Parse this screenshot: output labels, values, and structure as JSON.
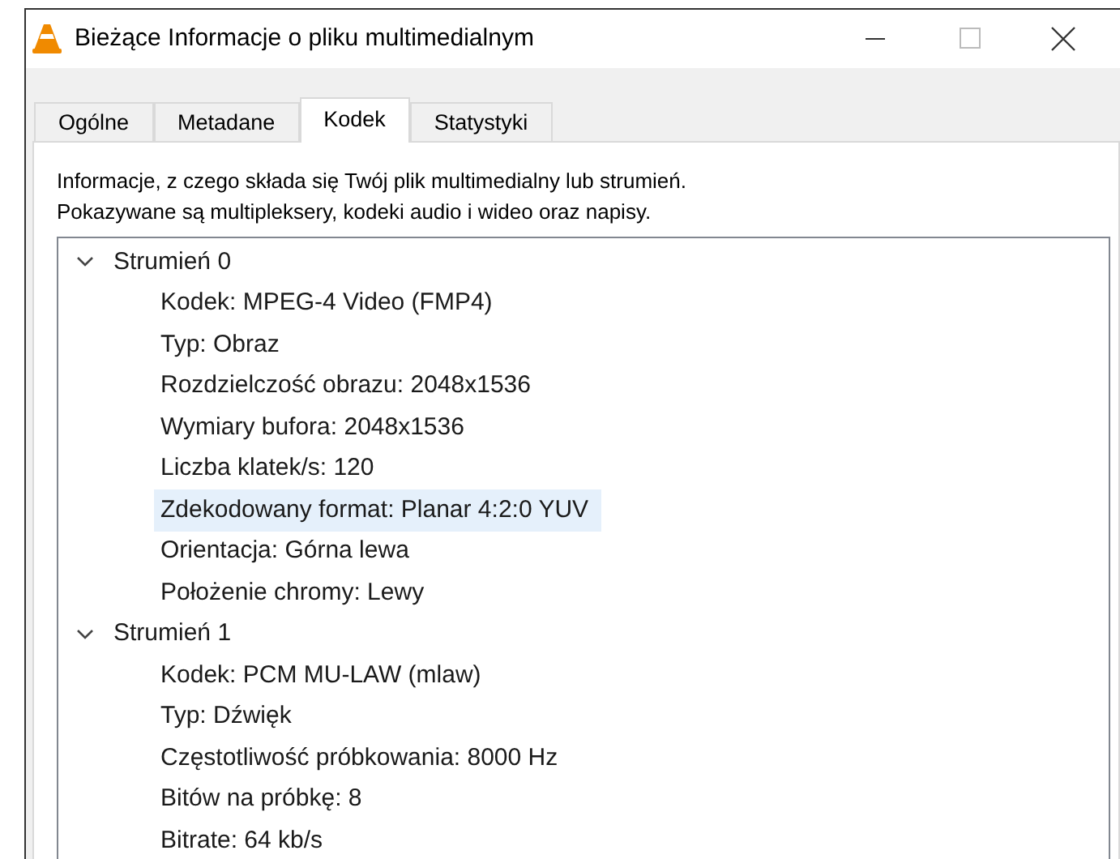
{
  "window": {
    "title": "Bieżące Informacje o pliku multimedialnym"
  },
  "tabs": [
    {
      "label": "Ogólne",
      "selected": false
    },
    {
      "label": "Metadane",
      "selected": false
    },
    {
      "label": "Kodek",
      "selected": true
    },
    {
      "label": "Statystyki",
      "selected": false
    }
  ],
  "description": [
    "Informacje, z czego składa się Twój plik multimedialny lub strumień.",
    "Pokazywane są multipleksery, kodeki audio i wideo oraz napisy."
  ],
  "tree": [
    {
      "label": "Strumień 0",
      "expanded": true,
      "children": [
        {
          "label": "Kodek: MPEG-4 Video (FMP4)",
          "selected": false
        },
        {
          "label": "Typ: Obraz",
          "selected": false
        },
        {
          "label": "Rozdzielczość obrazu: 2048x1536",
          "selected": false
        },
        {
          "label": "Wymiary bufora: 2048x1536",
          "selected": false
        },
        {
          "label": "Liczba klatek/s: 120",
          "selected": false
        },
        {
          "label": "Zdekodowany format: Planar 4:2:0 YUV",
          "selected": true
        },
        {
          "label": "Orientacja: Górna lewa",
          "selected": false
        },
        {
          "label": "Położenie chromy: Lewy",
          "selected": false
        }
      ]
    },
    {
      "label": "Strumień 1",
      "expanded": true,
      "children": [
        {
          "label": "Kodek: PCM MU-LAW (mlaw)",
          "selected": false
        },
        {
          "label": "Typ: Dźwięk",
          "selected": false
        },
        {
          "label": "Częstotliwość próbkowania: 8000 Hz",
          "selected": false
        },
        {
          "label": "Bitów na próbkę: 8",
          "selected": false
        },
        {
          "label": "Bitrate: 64 kb/s",
          "selected": false
        }
      ]
    }
  ]
}
